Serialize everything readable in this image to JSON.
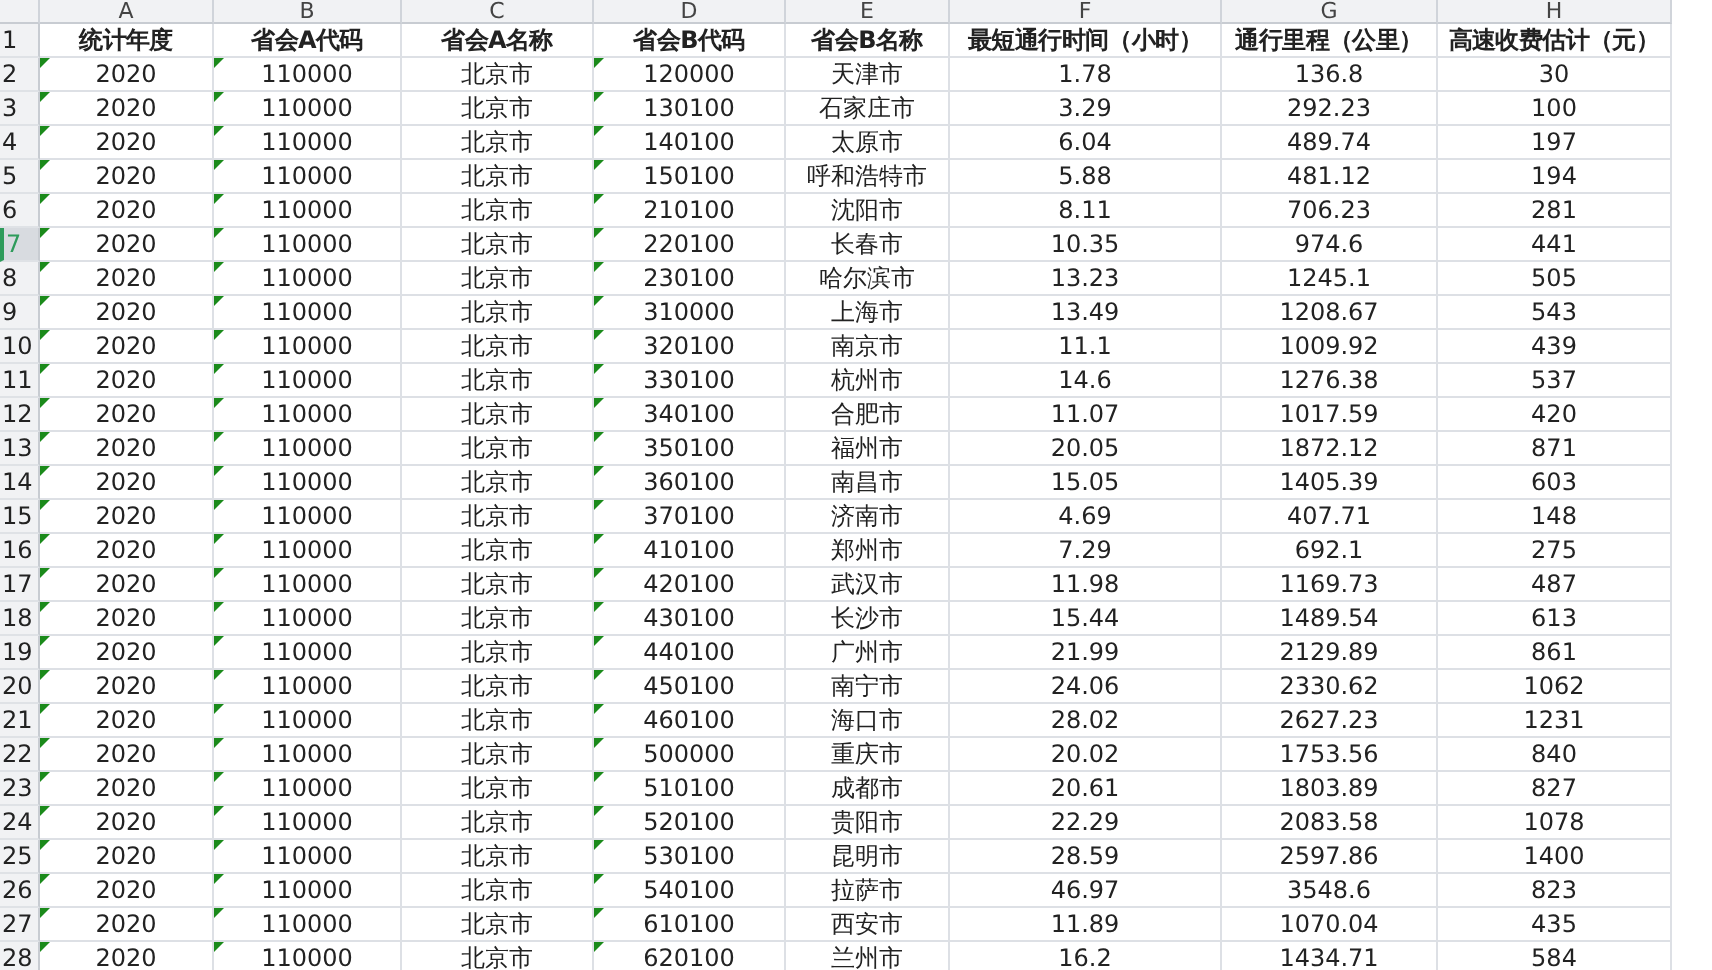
{
  "columns": [
    {
      "letter": "A",
      "flagged": true
    },
    {
      "letter": "B",
      "flagged": true
    },
    {
      "letter": "C",
      "flagged": false
    },
    {
      "letter": "D",
      "flagged": true
    },
    {
      "letter": "E",
      "flagged": false
    },
    {
      "letter": "F",
      "flagged": false
    },
    {
      "letter": "G",
      "flagged": false
    },
    {
      "letter": "H",
      "flagged": false
    }
  ],
  "header_row": {
    "number": "1",
    "cells": [
      "统计年度",
      "省会A代码",
      "省会A名称",
      "省会B代码",
      "省会B名称",
      "最短通行时间（小时）",
      "通行里程（公里）",
      "高速收费估计（元）"
    ]
  },
  "rows": [
    {
      "number": "2",
      "selected": false,
      "cells": [
        "2020",
        "110000",
        "北京市",
        "120000",
        "天津市",
        "1.78",
        "136.8",
        "30"
      ]
    },
    {
      "number": "3",
      "selected": false,
      "cells": [
        "2020",
        "110000",
        "北京市",
        "130100",
        "石家庄市",
        "3.29",
        "292.23",
        "100"
      ]
    },
    {
      "number": "4",
      "selected": false,
      "cells": [
        "2020",
        "110000",
        "北京市",
        "140100",
        "太原市",
        "6.04",
        "489.74",
        "197"
      ]
    },
    {
      "number": "5",
      "selected": false,
      "cells": [
        "2020",
        "110000",
        "北京市",
        "150100",
        "呼和浩特市",
        "5.88",
        "481.12",
        "194"
      ]
    },
    {
      "number": "6",
      "selected": false,
      "cells": [
        "2020",
        "110000",
        "北京市",
        "210100",
        "沈阳市",
        "8.11",
        "706.23",
        "281"
      ]
    },
    {
      "number": "7",
      "selected": true,
      "cells": [
        "2020",
        "110000",
        "北京市",
        "220100",
        "长春市",
        "10.35",
        "974.6",
        "441"
      ]
    },
    {
      "number": "8",
      "selected": false,
      "cells": [
        "2020",
        "110000",
        "北京市",
        "230100",
        "哈尔滨市",
        "13.23",
        "1245.1",
        "505"
      ]
    },
    {
      "number": "9",
      "selected": false,
      "cells": [
        "2020",
        "110000",
        "北京市",
        "310000",
        "上海市",
        "13.49",
        "1208.67",
        "543"
      ]
    },
    {
      "number": "10",
      "selected": false,
      "cells": [
        "2020",
        "110000",
        "北京市",
        "320100",
        "南京市",
        "11.1",
        "1009.92",
        "439"
      ]
    },
    {
      "number": "11",
      "selected": false,
      "cells": [
        "2020",
        "110000",
        "北京市",
        "330100",
        "杭州市",
        "14.6",
        "1276.38",
        "537"
      ]
    },
    {
      "number": "12",
      "selected": false,
      "cells": [
        "2020",
        "110000",
        "北京市",
        "340100",
        "合肥市",
        "11.07",
        "1017.59",
        "420"
      ]
    },
    {
      "number": "13",
      "selected": false,
      "cells": [
        "2020",
        "110000",
        "北京市",
        "350100",
        "福州市",
        "20.05",
        "1872.12",
        "871"
      ]
    },
    {
      "number": "14",
      "selected": false,
      "cells": [
        "2020",
        "110000",
        "北京市",
        "360100",
        "南昌市",
        "15.05",
        "1405.39",
        "603"
      ]
    },
    {
      "number": "15",
      "selected": false,
      "cells": [
        "2020",
        "110000",
        "北京市",
        "370100",
        "济南市",
        "4.69",
        "407.71",
        "148"
      ]
    },
    {
      "number": "16",
      "selected": false,
      "cells": [
        "2020",
        "110000",
        "北京市",
        "410100",
        "郑州市",
        "7.29",
        "692.1",
        "275"
      ]
    },
    {
      "number": "17",
      "selected": false,
      "cells": [
        "2020",
        "110000",
        "北京市",
        "420100",
        "武汉市",
        "11.98",
        "1169.73",
        "487"
      ]
    },
    {
      "number": "18",
      "selected": false,
      "cells": [
        "2020",
        "110000",
        "北京市",
        "430100",
        "长沙市",
        "15.44",
        "1489.54",
        "613"
      ]
    },
    {
      "number": "19",
      "selected": false,
      "cells": [
        "2020",
        "110000",
        "北京市",
        "440100",
        "广州市",
        "21.99",
        "2129.89",
        "861"
      ]
    },
    {
      "number": "20",
      "selected": false,
      "cells": [
        "2020",
        "110000",
        "北京市",
        "450100",
        "南宁市",
        "24.06",
        "2330.62",
        "1062"
      ]
    },
    {
      "number": "21",
      "selected": false,
      "cells": [
        "2020",
        "110000",
        "北京市",
        "460100",
        "海口市",
        "28.02",
        "2627.23",
        "1231"
      ]
    },
    {
      "number": "22",
      "selected": false,
      "cells": [
        "2020",
        "110000",
        "北京市",
        "500000",
        "重庆市",
        "20.02",
        "1753.56",
        "840"
      ]
    },
    {
      "number": "23",
      "selected": false,
      "cells": [
        "2020",
        "110000",
        "北京市",
        "510100",
        "成都市",
        "20.61",
        "1803.89",
        "827"
      ]
    },
    {
      "number": "24",
      "selected": false,
      "cells": [
        "2020",
        "110000",
        "北京市",
        "520100",
        "贵阳市",
        "22.29",
        "2083.58",
        "1078"
      ]
    },
    {
      "number": "25",
      "selected": false,
      "cells": [
        "2020",
        "110000",
        "北京市",
        "530100",
        "昆明市",
        "28.59",
        "2597.86",
        "1400"
      ]
    },
    {
      "number": "26",
      "selected": false,
      "cells": [
        "2020",
        "110000",
        "北京市",
        "540100",
        "拉萨市",
        "46.97",
        "3548.6",
        "823"
      ]
    },
    {
      "number": "27",
      "selected": false,
      "cells": [
        "2020",
        "110000",
        "北京市",
        "610100",
        "西安市",
        "11.89",
        "1070.04",
        "435"
      ]
    },
    {
      "number": "28",
      "selected": false,
      "cells": [
        "2020",
        "110000",
        "北京市",
        "620100",
        "兰州市",
        "16.2",
        "1434.71",
        "584"
      ]
    }
  ]
}
